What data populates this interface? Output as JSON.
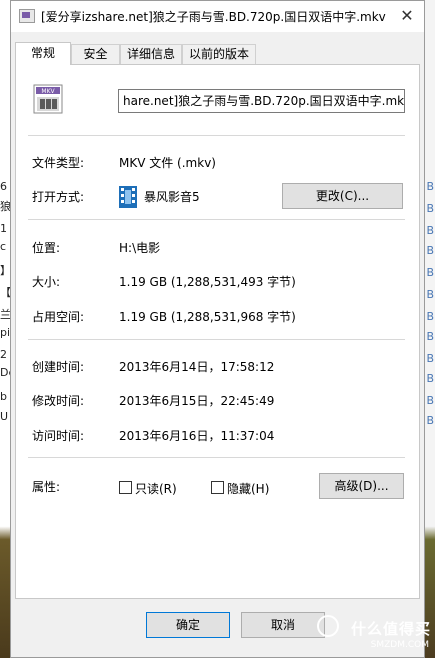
{
  "window": {
    "title": "[爱分享izshare.net]狼之子雨与雪.BD.720p.国日双语中字.mkv 属...",
    "close_symbol": "✕"
  },
  "tabs": [
    "常规",
    "安全",
    "详细信息",
    "以前的版本"
  ],
  "general": {
    "file_name": "hare.net]狼之子雨与雪.BD.720p.国日双语中字.mkv",
    "file_icon": "mkv-file-icon",
    "file_icon_text": "MKV",
    "type_label": "文件类型:",
    "type_value": "MKV 文件 (.mkv)",
    "opens_with_label": "打开方式:",
    "opens_with_value": "暴风影音5",
    "change_button": "更改(C)...",
    "location_label": "位置:",
    "location_value": "H:\\电影",
    "size_label": "大小:",
    "size_value": "1.19 GB (1,288,531,493 字节)",
    "size_on_disk_label": "占用空间:",
    "size_on_disk_value": "1.19 GB (1,288,531,968 字节)",
    "created_label": "创建时间:",
    "created_value": "2013年6月14日，17:58:12",
    "modified_label": "修改时间:",
    "modified_value": "2013年6月15日，22:45:49",
    "accessed_label": "访问时间:",
    "accessed_value": "2013年6月16日，11:37:04",
    "attributes_label": "属性:",
    "readonly_label": "只读(R)",
    "hidden_label": "隐藏(H)",
    "advanced_button": "高级(D)..."
  },
  "buttons": {
    "ok": "确定",
    "cancel": "取消"
  },
  "background": {
    "left_fragments": [
      "6",
      "狼",
      "1",
      "c",
      "】",
      "【",
      "兰",
      "pi",
      "2",
      "De",
      "b",
      "U"
    ],
    "right_fragments": [
      "B",
      "B",
      "B",
      "B",
      "B",
      "B",
      "B",
      "B",
      "B",
      "B",
      "B",
      "B"
    ]
  },
  "watermark": {
    "text": "什么值得买",
    "sub": "SMZDM.COM"
  }
}
